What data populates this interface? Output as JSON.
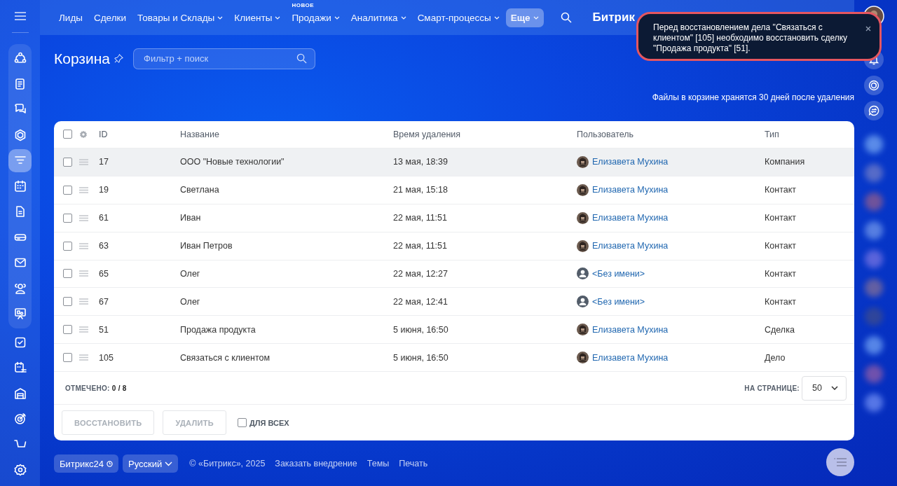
{
  "top_nav": {
    "items": [
      {
        "label": "Лиды",
        "dropdown": false,
        "selected": false
      },
      {
        "label": "Сделки",
        "dropdown": false,
        "selected": false
      },
      {
        "label": "Товары и Склады",
        "dropdown": true,
        "selected": false
      },
      {
        "label": "Клиенты",
        "dropdown": true,
        "selected": false
      },
      {
        "label": "Продажи",
        "dropdown": true,
        "selected": false,
        "badge": "НОВОЕ"
      },
      {
        "label": "Аналитика",
        "dropdown": true,
        "selected": false
      },
      {
        "label": "Смарт-процессы",
        "dropdown": true,
        "selected": false
      },
      {
        "label": "Еще",
        "dropdown": true,
        "selected": true
      }
    ],
    "logo": "Битрик"
  },
  "left_sidebar": {
    "items": [
      {
        "selected": false,
        "group": true
      },
      {
        "selected": false,
        "group": true
      },
      {
        "selected": false,
        "group": true
      },
      {
        "selected": false,
        "group": true
      },
      {
        "selected": true,
        "group": true
      },
      {
        "selected": false,
        "group": true
      },
      {
        "selected": false,
        "group": true
      },
      {
        "selected": false,
        "group": true
      },
      {
        "selected": false,
        "group": true
      },
      {
        "selected": false,
        "group": true
      },
      {
        "selected": false,
        "group": true
      },
      {
        "selected": false,
        "group": false
      },
      {
        "selected": false,
        "group": false
      },
      {
        "selected": false,
        "group": false
      },
      {
        "selected": false,
        "group": false
      },
      {
        "selected": false,
        "group": false
      },
      {
        "selected": false,
        "group": false
      }
    ]
  },
  "page": {
    "title": "Корзина",
    "filter": {
      "placeholder": "Фильтр + поиск"
    },
    "notice": "Файлы в корзине хранятся 30 дней после удаления"
  },
  "toast": {
    "text": "Перед восстановлением дела \"Связаться с клиентом\" [105] необходимо восстановить сделку \"Продажа продукта\" [51]."
  },
  "table": {
    "all_checked": false,
    "columns": [
      "ID",
      "Название",
      "Время удаления",
      "Пользователь",
      "Тип"
    ],
    "rows": [
      {
        "checked": false,
        "highlighted": true,
        "id": "17",
        "name": "ООО \"Новые технологии\"",
        "deleted": "13 мая, 18:39",
        "user": "Елизавета Мухина",
        "kind": "photo",
        "type": "Компания"
      },
      {
        "checked": false,
        "highlighted": false,
        "id": "19",
        "name": "Светлана",
        "deleted": "21 мая, 15:18",
        "user": "Елизавета Мухина",
        "kind": "photo",
        "type": "Контакт"
      },
      {
        "checked": false,
        "highlighted": false,
        "id": "61",
        "name": "Иван",
        "deleted": "22 мая, 11:51",
        "user": "Елизавета Мухина",
        "kind": "photo",
        "type": "Контакт"
      },
      {
        "checked": false,
        "highlighted": false,
        "id": "63",
        "name": "Иван Петров",
        "deleted": "22 мая, 11:51",
        "user": "Елизавета Мухина",
        "kind": "photo",
        "type": "Контакт"
      },
      {
        "checked": false,
        "highlighted": false,
        "id": "65",
        "name": "Олег",
        "deleted": "22 мая, 12:27",
        "user": "<Без имени>",
        "kind": "placeholder",
        "type": "Контакт"
      },
      {
        "checked": false,
        "highlighted": false,
        "id": "67",
        "name": "Олег",
        "deleted": "22 мая, 12:41",
        "user": "<Без имени>",
        "kind": "placeholder",
        "type": "Контакт"
      },
      {
        "checked": false,
        "highlighted": false,
        "id": "51",
        "name": "Продажа продукта",
        "deleted": "5 июня, 16:50",
        "user": "Елизавета Мухина",
        "kind": "photo",
        "type": "Сделка"
      },
      {
        "checked": false,
        "highlighted": false,
        "id": "105",
        "name": "Связаться с клиентом",
        "deleted": "5 июня, 16:50",
        "user": "Елизавета Мухина",
        "kind": "photo",
        "type": "Дело"
      }
    ],
    "marked_label": "ОТМЕЧЕНО:",
    "marked_value": "0 / 8",
    "per_page_label": "НА СТРАНИЦЕ:",
    "per_page": "50",
    "actions": [
      {
        "label": "ВОССТАНОВИТЬ",
        "disabled": true
      },
      {
        "label": "УДАЛИТЬ",
        "disabled": true
      }
    ],
    "for_all": {
      "label": "ДЛЯ ВСЕХ",
      "checked": false
    }
  },
  "footer": {
    "brand": "Битрикс24",
    "language": "Русский",
    "copyright": "© «Битрикс», 2025",
    "links": [
      "Заказать внедрение",
      "Темы",
      "Печать"
    ]
  }
}
